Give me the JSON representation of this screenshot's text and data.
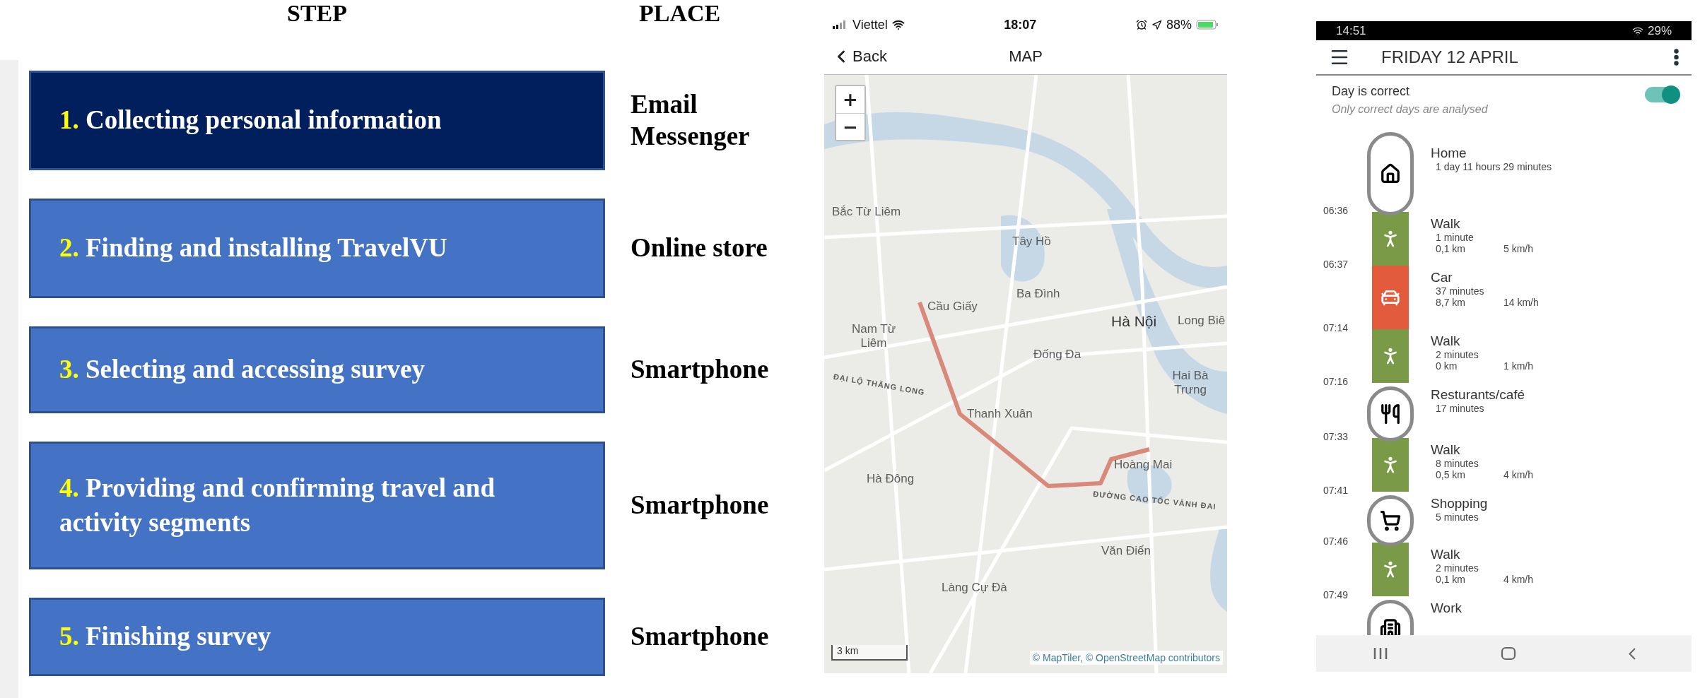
{
  "steps_header": "STEP",
  "places_header": "PLACE",
  "steps": [
    {
      "number": "1.",
      "label": "Collecting personal information",
      "selected": true,
      "place": [
        "Email",
        "Messenger"
      ]
    },
    {
      "number": "2.",
      "label": "Finding and installing TravelVU",
      "selected": false,
      "place": [
        "Online store"
      ]
    },
    {
      "number": "3.",
      "label": "Selecting and accessing survey",
      "selected": false,
      "place": [
        "Smartphone"
      ]
    },
    {
      "number": "4.",
      "label": "Providing and confirming travel and activity segments",
      "selected": false,
      "place": [
        "Smartphone"
      ]
    },
    {
      "number": "5.",
      "label": "Finishing survey",
      "selected": false,
      "place": [
        "Smartphone"
      ]
    }
  ],
  "map_phone": {
    "status_bar": {
      "carrier": "Viettel",
      "time": "18:07",
      "battery": "88%"
    },
    "nav": {
      "back": "Back",
      "title": "MAP"
    },
    "map": {
      "zoom_in": "+",
      "zoom_out": "−",
      "labels": [
        {
          "text": "Bắc Từ Liêm",
          "kind": "district"
        },
        {
          "text": "Tây Hồ",
          "kind": "district"
        },
        {
          "text": "Ba Đình",
          "kind": "district"
        },
        {
          "text": "Cầu Giấy",
          "kind": "district"
        },
        {
          "text": "Nam Từ Liêm",
          "kind": "district"
        },
        {
          "text": "Hà Nội",
          "kind": "city"
        },
        {
          "text": "Long Biê",
          "kind": "district"
        },
        {
          "text": "Đống Đa",
          "kind": "district"
        },
        {
          "text": "Hai Bà Trưng",
          "kind": "district"
        },
        {
          "text": "ĐẠI LỘ THĂNG LONG",
          "kind": "road"
        },
        {
          "text": "Thanh Xuân",
          "kind": "district"
        },
        {
          "text": "Hà Đông",
          "kind": "district"
        },
        {
          "text": "Hoàng Mai",
          "kind": "district"
        },
        {
          "text": "ĐƯỜNG CAO TỐC VÀNH ĐAI",
          "kind": "road"
        },
        {
          "text": "Văn Điển",
          "kind": "district"
        },
        {
          "text": "Làng Cự Đà",
          "kind": "district"
        }
      ],
      "scale": "3 km",
      "attribution": "© MapTiler, © OpenStreetMap contributors"
    }
  },
  "diary_phone": {
    "status_bar": {
      "time": "14:51",
      "battery": "29%"
    },
    "app_bar": {
      "title": "FRIDAY 12 APRIL"
    },
    "day_check": {
      "label": "Day is correct",
      "hint": "Only correct days are analysed",
      "on": true
    },
    "timeline": [
      {
        "kind": "home",
        "title": "Home",
        "details": [
          "1 day 11 hours 29 minutes"
        ]
      },
      {
        "kind": "walk",
        "time": "06:36",
        "title": "Walk",
        "details": [
          "1 minute"
        ],
        "distance": "0,1 km",
        "speed": "5 km/h",
        "color": "#7a9a47"
      },
      {
        "kind": "car",
        "time": "06:37",
        "title": "Car",
        "details": [
          "37 minutes"
        ],
        "distance": "8,7 km",
        "speed": "14 km/h",
        "color": "#e15b3c"
      },
      {
        "kind": "walk",
        "time": "07:14",
        "title": "Walk",
        "details": [
          "2 minutes"
        ],
        "distance": "0 km",
        "speed": "1 km/h",
        "color": "#7a9a47"
      },
      {
        "kind": "restaurant",
        "time": "07:16",
        "title": "Resturants/café",
        "details": [
          "17 minutes"
        ]
      },
      {
        "kind": "walk",
        "time": "07:33",
        "title": "Walk",
        "details": [
          "8 minutes"
        ],
        "distance": "0,5 km",
        "speed": "4 km/h",
        "color": "#7a9a47"
      },
      {
        "kind": "shopping",
        "time": "07:41",
        "title": "Shopping",
        "details": [
          "5 minutes"
        ]
      },
      {
        "kind": "walk",
        "time": "07:46",
        "title": "Walk",
        "details": [
          "2 minutes"
        ],
        "distance": "0,1 km",
        "speed": "4 km/h",
        "color": "#7a9a47"
      },
      {
        "kind": "work",
        "time": "07:49",
        "title": "Work"
      }
    ]
  }
}
